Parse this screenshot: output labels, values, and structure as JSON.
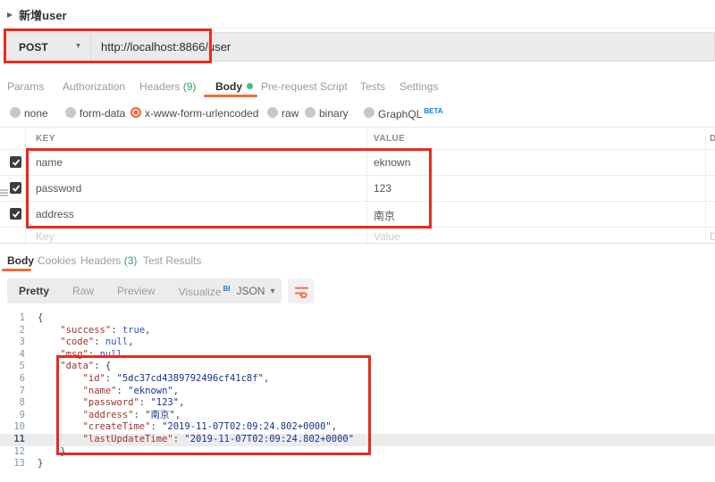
{
  "colors": {
    "accent_orange": "#f26b3a",
    "annotation_red": "#e92a1e",
    "count_green": "#2e9e68",
    "beta_blue": "#0d7fe8"
  },
  "request": {
    "title": "新增user",
    "method": "POST",
    "url": "http://localhost:8866/user",
    "tabs": [
      {
        "label": "Params"
      },
      {
        "label": "Authorization"
      },
      {
        "label": "Headers",
        "count": "(9)"
      },
      {
        "label": "Body",
        "active": true,
        "dot": true
      },
      {
        "label": "Pre-request Script"
      },
      {
        "label": "Tests"
      },
      {
        "label": "Settings"
      }
    ],
    "body_modes": [
      {
        "label": "none"
      },
      {
        "label": "form-data"
      },
      {
        "label": "x-www-form-urlencoded",
        "selected": true
      },
      {
        "label": "raw"
      },
      {
        "label": "binary"
      },
      {
        "label": "GraphQL",
        "badge": "BETA"
      }
    ],
    "kv_table": {
      "key_header": "KEY",
      "value_header": "VALUE",
      "desc_header": "D",
      "rows": [
        {
          "key": "name",
          "value": "eknown",
          "checked": true
        },
        {
          "key": "password",
          "value": "123",
          "checked": true,
          "drag": true
        },
        {
          "key": "address",
          "value": "南京",
          "checked": true
        }
      ],
      "placeholder_key": "Key",
      "placeholder_value": "Value",
      "placeholder_desc": "D"
    }
  },
  "response": {
    "tabs": [
      {
        "label": "Body",
        "active": true
      },
      {
        "label": "Cookies"
      },
      {
        "label": "Headers",
        "count": "(3)"
      },
      {
        "label": "Test Results"
      }
    ],
    "view_modes": [
      {
        "label": "Pretty",
        "active": true
      },
      {
        "label": "Raw"
      },
      {
        "label": "Preview"
      },
      {
        "label": "Visualize",
        "badge": "BETA"
      }
    ],
    "language": "JSON",
    "code": {
      "lines": [
        {
          "n": 1,
          "tokens": [
            [
              "p",
              "{"
            ]
          ]
        },
        {
          "n": 2,
          "tokens": [
            [
              "p",
              "    "
            ],
            [
              "k",
              "\"success\""
            ],
            [
              "p",
              ": "
            ],
            [
              "a",
              "true"
            ],
            [
              "p",
              ","
            ]
          ]
        },
        {
          "n": 3,
          "tokens": [
            [
              "p",
              "    "
            ],
            [
              "k",
              "\"code\""
            ],
            [
              "p",
              ": "
            ],
            [
              "a",
              "null"
            ],
            [
              "p",
              ","
            ]
          ]
        },
        {
          "n": 4,
          "tokens": [
            [
              "p",
              "    "
            ],
            [
              "k",
              "\"msg\""
            ],
            [
              "p",
              ": "
            ],
            [
              "a",
              "null"
            ],
            [
              "p",
              ","
            ]
          ]
        },
        {
          "n": 5,
          "tokens": [
            [
              "p",
              "    "
            ],
            [
              "k",
              "\"data\""
            ],
            [
              "p",
              ": {"
            ]
          ]
        },
        {
          "n": 6,
          "tokens": [
            [
              "p",
              "        "
            ],
            [
              "k",
              "\"id\""
            ],
            [
              "p",
              ": "
            ],
            [
              "s",
              "\"5dc37cd4389792496cf41c8f\""
            ],
            [
              "p",
              ","
            ]
          ]
        },
        {
          "n": 7,
          "tokens": [
            [
              "p",
              "        "
            ],
            [
              "k",
              "\"name\""
            ],
            [
              "p",
              ": "
            ],
            [
              "s",
              "\"eknown\""
            ],
            [
              "p",
              ","
            ]
          ]
        },
        {
          "n": 8,
          "tokens": [
            [
              "p",
              "        "
            ],
            [
              "k",
              "\"password\""
            ],
            [
              "p",
              ": "
            ],
            [
              "s",
              "\"123\""
            ],
            [
              "p",
              ","
            ]
          ]
        },
        {
          "n": 9,
          "tokens": [
            [
              "p",
              "        "
            ],
            [
              "k",
              "\"address\""
            ],
            [
              "p",
              ": "
            ],
            [
              "s",
              "\"南京\""
            ],
            [
              "p",
              ","
            ]
          ]
        },
        {
          "n": 10,
          "tokens": [
            [
              "p",
              "        "
            ],
            [
              "k",
              "\"createTime\""
            ],
            [
              "p",
              ": "
            ],
            [
              "s",
              "\"2019-11-07T02:09:24.802+0000\""
            ],
            [
              "p",
              ","
            ]
          ]
        },
        {
          "n": 11,
          "highlight": true,
          "tokens": [
            [
              "p",
              "        "
            ],
            [
              "k",
              "\"lastUpdateTime\""
            ],
            [
              "p",
              ": "
            ],
            [
              "s",
              "\"2019-11-07T02:09:24.802+0000\""
            ]
          ]
        },
        {
          "n": 12,
          "tokens": [
            [
              "p",
              "    }"
            ]
          ]
        },
        {
          "n": 13,
          "tokens": [
            [
              "p",
              "}"
            ]
          ]
        }
      ]
    }
  }
}
